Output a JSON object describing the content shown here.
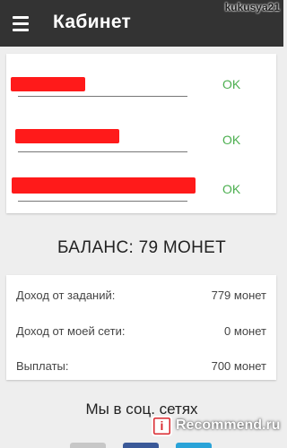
{
  "appbar": {
    "title": "Кабинет",
    "menu_icon": "hamburger-menu-icon",
    "background": "#333333"
  },
  "watermark": "kukusya21",
  "fields": [
    {
      "status": "OK"
    },
    {
      "status": "OK"
    },
    {
      "status": "OK"
    }
  ],
  "colors": {
    "ok": "#4caf50",
    "redaction": "#ff1a1a"
  },
  "balance": {
    "text": "БАЛАНС: 79 МОНЕТ"
  },
  "stats": [
    {
      "label": "Доход от заданий:",
      "value": "779 монет"
    },
    {
      "label": "Доход от моей сети:",
      "value": "0 монет"
    },
    {
      "label": "Выплаты:",
      "value": "700 монет"
    }
  ],
  "social": {
    "title": "Мы в соц. сетях"
  },
  "badge": {
    "logo_letter": "i",
    "text": "Recommend.ru"
  }
}
